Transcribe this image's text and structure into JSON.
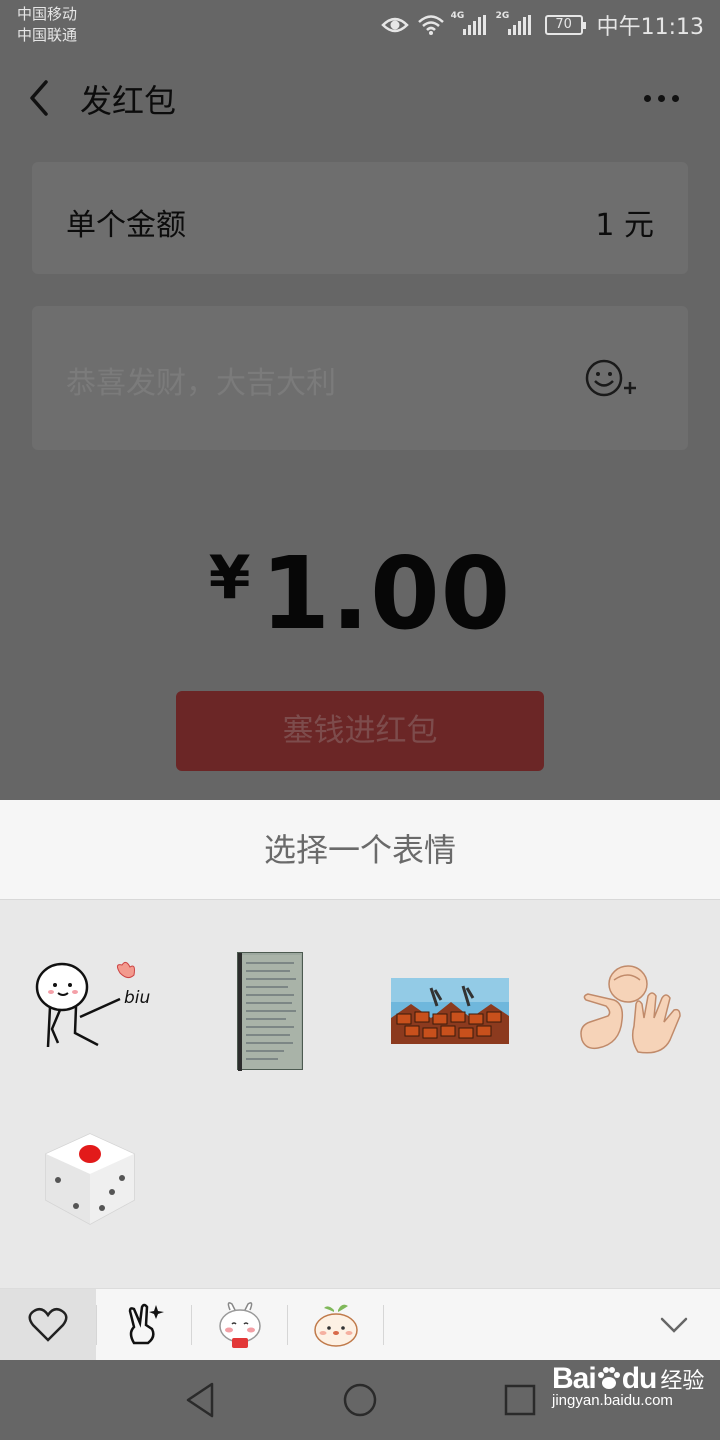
{
  "status_bar": {
    "carrier_1": "中国移动",
    "carrier_2": "中国联通",
    "network_1": "4G",
    "network_2": "2G",
    "battery": "70",
    "time": "中午11:13"
  },
  "header": {
    "title": "发红包"
  },
  "amount": {
    "label": "单个金额",
    "value": "1 元"
  },
  "blessing": {
    "placeholder": "恭喜发财，大吉大利"
  },
  "total": {
    "currency": "¥",
    "value": "1.00"
  },
  "submit_label": "塞钱进红包",
  "picker": {
    "title": "选择一个表情",
    "stickers": [
      {
        "name": "biu-sticker",
        "text": "biu"
      },
      {
        "name": "handwritten-note-photo"
      },
      {
        "name": "game-screenshot"
      },
      {
        "name": "rock-paper-scissors"
      },
      {
        "name": "dice"
      }
    ],
    "tabs": [
      "favorites",
      "gesture-pack",
      "bunny-pack",
      "peach-pack"
    ]
  },
  "watermark": {
    "logo": "Bai",
    "logo2": "du",
    "cn": "经验",
    "url": "jingyan.baidu.com"
  },
  "colors": {
    "accent_red": "#6b2626",
    "sheet_bg": "#e8e8e8",
    "overlay": "#666666"
  }
}
